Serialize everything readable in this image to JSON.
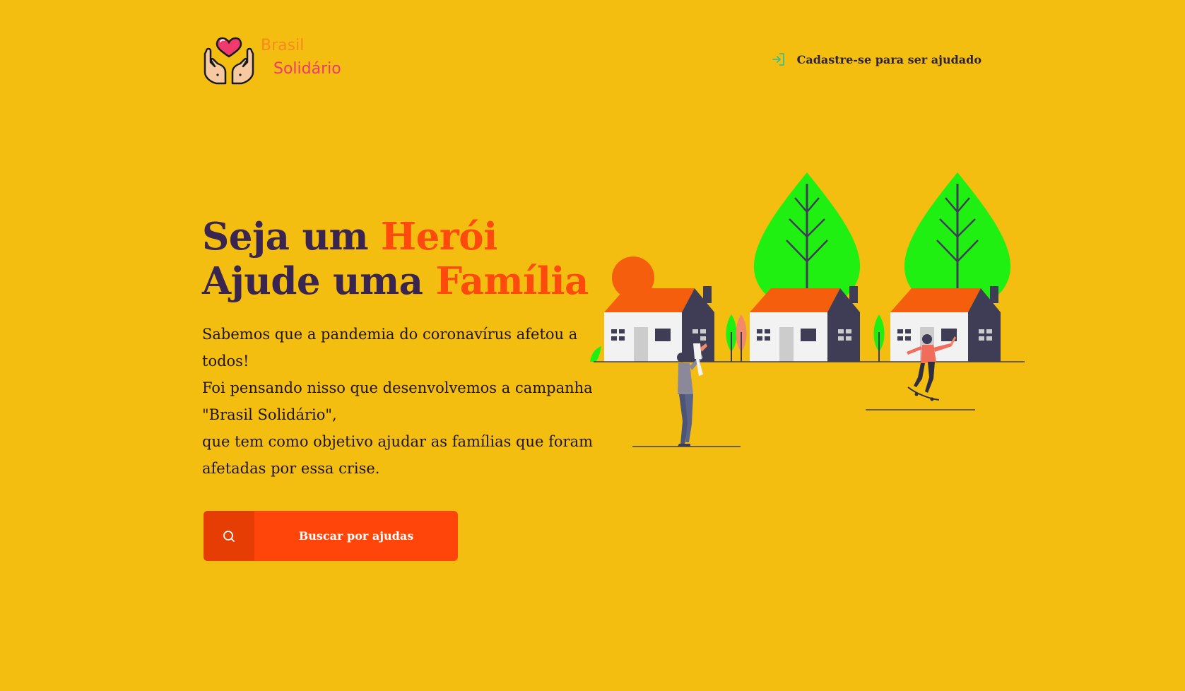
{
  "header": {
    "logo": {
      "word1": "Brasil",
      "word2": "Solidário",
      "icon": "heart-hands-icon"
    },
    "register_link": {
      "label": "Cadastre-se para ser ajudado",
      "icon": "login-arrow-icon"
    }
  },
  "hero": {
    "title_line1_prefix": "Seja um ",
    "title_line1_accent": "Herói",
    "title_line2_prefix": "Ajude uma ",
    "title_line2_accent": "Família",
    "description": [
      "Sabemos que a pandemia do coronavírus afetou a todos!",
      "Foi pensando nisso que desenvolvemos a campanha \"Brasil Solidário\",",
      "que tem como objetivo ajudar as famílias que foram afetadas por essa crise."
    ],
    "cta": {
      "label": "Buscar por ajudas",
      "icon": "search-icon"
    }
  },
  "illustration": {
    "subject": "houses-trees-family-illustration"
  },
  "colors": {
    "background": "#F3BE10",
    "title": "#3A2450",
    "accent": "#FE4A0C",
    "button": "#FF4509",
    "button_icon_box": "#E63D04",
    "logo_word1": "#F68A1E",
    "logo_word2": "#F03A6E",
    "register_icon": "#3DBE8A"
  }
}
